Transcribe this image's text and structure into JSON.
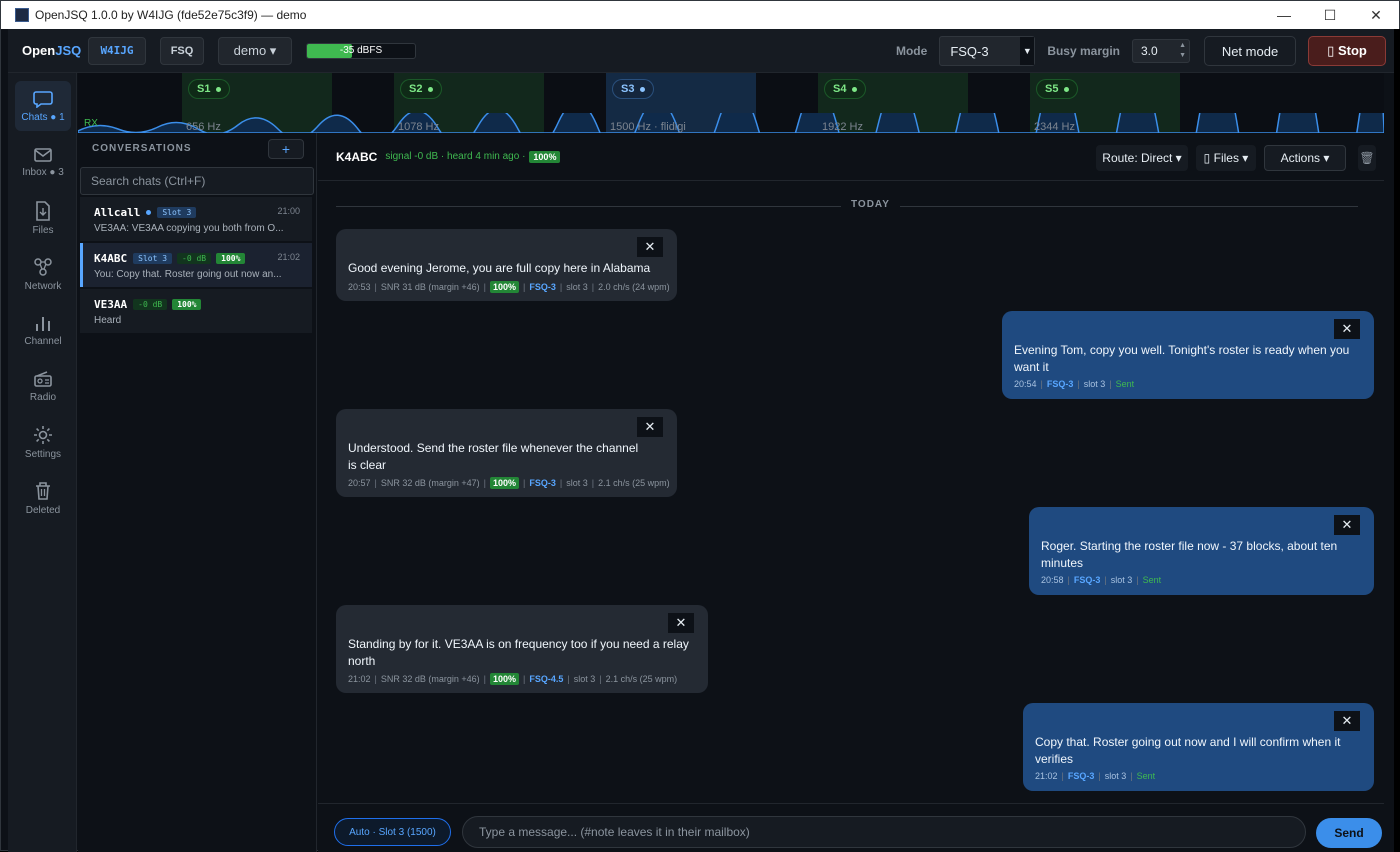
{
  "window": {
    "title": "OpenJSQ 1.0.0 by W4IJG (fde52e75c3f9) — demo",
    "minimize": "—",
    "maximize": "☐",
    "close": "✕"
  },
  "topbar": {
    "brand_a": "Open",
    "brand_b": "JSQ",
    "callsign": "W4IJG",
    "mode_chip": "FSQ",
    "profile": "demo ▾",
    "meter_text": "-35 dBFS",
    "meter_level": 0.42,
    "mode_label": "Mode",
    "mode_value": "FSQ-3",
    "busy_label": "Busy margin",
    "busy_value": "3.0",
    "net_mode": "Net mode",
    "stop": "▯ Stop"
  },
  "nav": [
    {
      "label": "Chats ● 1",
      "icon": "chat-icon"
    },
    {
      "label": "Inbox ● 3",
      "icon": "inbox-icon"
    },
    {
      "label": "Files",
      "icon": "file-icon"
    },
    {
      "label": "Network",
      "icon": "network-icon"
    },
    {
      "label": "Channel",
      "icon": "bar-chart-icon"
    },
    {
      "label": "Radio",
      "icon": "radio-icon"
    },
    {
      "label": "Settings",
      "icon": "gear-icon"
    },
    {
      "label": "Deleted",
      "icon": "trash-icon"
    }
  ],
  "waterfall": {
    "rx": "RX",
    "slots": [
      {
        "label": "S1",
        "freq": "656 Hz"
      },
      {
        "label": "S2",
        "freq": "1078 Hz"
      },
      {
        "label": "S3",
        "freq": "1500 Hz · flidigi"
      },
      {
        "label": "S4",
        "freq": "1922 Hz"
      },
      {
        "label": "S5",
        "freq": "2344 Hz"
      }
    ]
  },
  "conversations": {
    "header": "CONVERSATIONS",
    "add": "+",
    "search_placeholder": "Search chats  (Ctrl+F)",
    "items": [
      {
        "name": "Allcall",
        "slot": "Slot 3",
        "time": "21:00",
        "preview": "VE3AA: VE3AA copying you both from O..."
      },
      {
        "name": "K4ABC",
        "slot": "Slot 3",
        "db": "-0 dB",
        "pct": "100%",
        "time": "21:02",
        "preview": "You: Copy that. Roster going out now an..."
      },
      {
        "name": "VE3AA",
        "db": "-0 dB",
        "pct": "100%",
        "preview": "Heard"
      }
    ]
  },
  "chat": {
    "name": "K4ABC",
    "signal": "signal -0 dB · heard 4 min ago ·",
    "pct": "100%",
    "route": "Route: Direct ▾",
    "files": "▯ Files ▾",
    "actions": "Actions ▾",
    "trash": "🗑",
    "day": "TODAY",
    "messages": [
      {
        "dir": "in",
        "text": "Good evening Jerome, you are full copy here in Alabama",
        "time": "20:53",
        "snr": "SNR 31 dB (margin +46)",
        "pct": "100%",
        "mode": "FSQ-3",
        "slot": "slot 3",
        "rate": "2.0 ch/s (24 wpm)"
      },
      {
        "dir": "out",
        "text": "Evening Tom, copy you well. Tonight's roster is ready when you want it",
        "time": "20:54",
        "mode": "FSQ-3",
        "slot": "slot 3",
        "status": "Sent"
      },
      {
        "dir": "in",
        "text": "Understood. Send the roster file whenever the channel is clear",
        "time": "20:57",
        "snr": "SNR 32 dB (margin +47)",
        "pct": "100%",
        "mode": "FSQ-3",
        "slot": "slot 3",
        "rate": "2.1 ch/s (25 wpm)"
      },
      {
        "dir": "out",
        "text": "Roger. Starting the roster file now - 37 blocks, about ten minutes",
        "time": "20:58",
        "mode": "FSQ-3",
        "slot": "slot 3",
        "status": "Sent"
      },
      {
        "dir": "in",
        "text": "Standing by for it. VE3AA is on frequency too if you need a relay north",
        "time": "21:02",
        "snr": "SNR 32 dB (margin +46)",
        "pct": "100%",
        "mode": "FSQ-4.5",
        "slot": "slot 3",
        "rate": "2.1 ch/s (25 wpm)"
      },
      {
        "dir": "out",
        "text": "Copy that. Roster going out now and I will confirm when it verifies",
        "time": "21:02",
        "mode": "FSQ-3",
        "slot": "slot 3",
        "status": "Sent"
      }
    ],
    "auto": "Auto · Slot 3 (1500)",
    "input_placeholder": "Type a message... (#note leaves it in their mailbox)",
    "send": "Send"
  }
}
